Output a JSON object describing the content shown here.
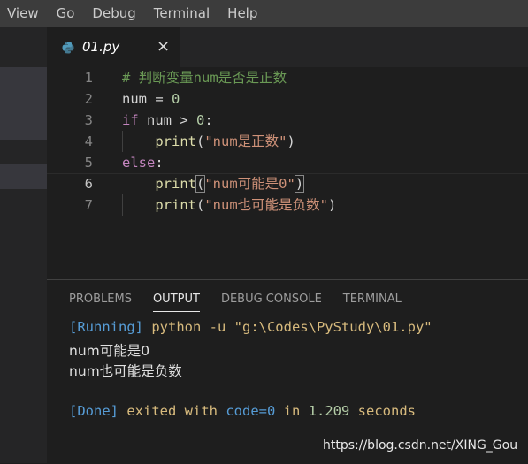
{
  "menu": [
    "View",
    "Go",
    "Debug",
    "Terminal",
    "Help"
  ],
  "tab": {
    "filename": "01.py",
    "close": "×"
  },
  "editor": {
    "lines": [
      {
        "num": "1",
        "parts": [
          {
            "t": "# 判断变量num是否是正数",
            "c": "comment"
          }
        ]
      },
      {
        "num": "2",
        "parts": [
          {
            "t": "num",
            "c": "var"
          },
          {
            "t": " = ",
            "c": "op"
          },
          {
            "t": "0",
            "c": "num"
          }
        ]
      },
      {
        "num": "3",
        "parts": [
          {
            "t": "if",
            "c": "kw"
          },
          {
            "t": " num > ",
            "c": "var"
          },
          {
            "t": "0",
            "c": "num"
          },
          {
            "t": ":",
            "c": "op"
          }
        ]
      },
      {
        "num": "4",
        "parts": [
          {
            "t": "    ",
            "c": "op"
          },
          {
            "t": "print",
            "c": "fn"
          },
          {
            "t": "(",
            "c": "op"
          },
          {
            "t": "\"num是正数\"",
            "c": "str"
          },
          {
            "t": ")",
            "c": "op"
          }
        ]
      },
      {
        "num": "5",
        "parts": [
          {
            "t": "else",
            "c": "kw"
          },
          {
            "t": ":",
            "c": "op"
          }
        ]
      },
      {
        "num": "6",
        "parts": [
          {
            "t": "    ",
            "c": "op"
          },
          {
            "t": "print",
            "c": "fn"
          },
          {
            "t": "(",
            "c": "op",
            "box": true
          },
          {
            "t": "\"num可能是0\"",
            "c": "str"
          },
          {
            "t": ")",
            "c": "op",
            "box": true
          }
        ]
      },
      {
        "num": "7",
        "parts": [
          {
            "t": "    ",
            "c": "op"
          },
          {
            "t": "print",
            "c": "fn"
          },
          {
            "t": "(",
            "c": "op"
          },
          {
            "t": "\"num也可能是负数\"",
            "c": "str"
          },
          {
            "t": ")",
            "c": "op"
          }
        ]
      }
    ],
    "active_line": "6"
  },
  "panel": {
    "tabs": [
      "PROBLEMS",
      "OUTPUT",
      "DEBUG CONSOLE",
      "TERMINAL"
    ],
    "active_tab": "OUTPUT",
    "output": {
      "running_tag": "[Running]",
      "command": " python -u \"g:\\Codes\\PyStudy\\01.py\"",
      "line1": "num可能是0",
      "line2": "num也可能是负数",
      "done_tag": "[Done]",
      "done_text1": " exited with ",
      "done_code": "code=0",
      "done_text2": " in ",
      "done_time": "1.209",
      "done_text3": " seconds"
    }
  },
  "watermark": "https://blog.csdn.net/XING_Gou",
  "colors": {
    "comment": "#6a9955",
    "keyword": "#c586c0",
    "number": "#b5cea8",
    "string": "#ce9178",
    "function": "#dcdcaa"
  }
}
